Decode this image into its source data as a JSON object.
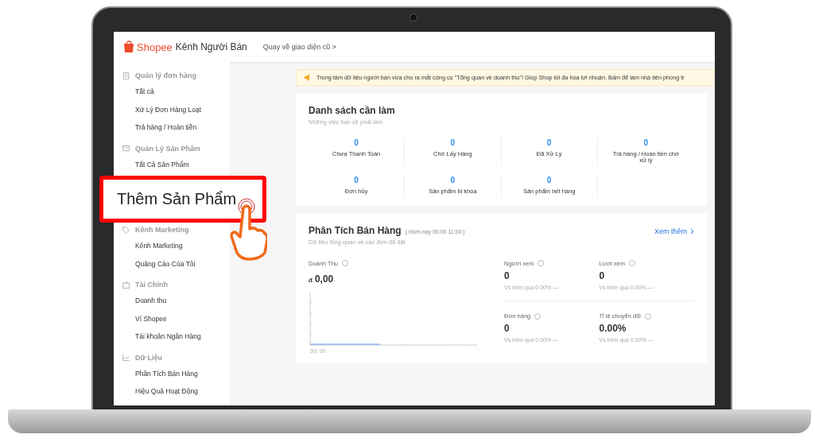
{
  "header": {
    "brand": "Shopee",
    "title": "Kênh Người Bán",
    "link": "Quay về giao diện cũ >"
  },
  "sidebar": {
    "groups": [
      {
        "title": "Quản lý đơn hàng",
        "items": [
          "Tất cả",
          "Xử Lý Đơn Hàng Loạt",
          "Trả hàng / Hoàn tiền"
        ]
      },
      {
        "title": "Quản Lý Sản Phẩm",
        "items": [
          "Tất Cả Sản Phẩm"
        ]
      },
      {
        "title": "Kênh Marketing",
        "items": [
          "Kênh Marketing",
          "Quảng Cáo Của Tôi"
        ]
      },
      {
        "title": "Tài Chính",
        "items": [
          "Doanh thu",
          "Ví Shopee",
          "Tài khoản Ngân Hàng"
        ]
      },
      {
        "title": "Dữ Liệu",
        "items": [
          "Phân Tích Bán Hàng",
          "Hiệu Quả Hoạt Động"
        ]
      }
    ]
  },
  "callout": {
    "label": "Thêm Sản Phẩm"
  },
  "notice": "Trung tâm dữ liệu người bán vừa cho ra mắt công cụ \"Tổng quan về doanh thu\"! Giúp Shop tối đa hóa lợi nhuận. Bấm để làm nhà tiên phong tr",
  "todo": {
    "title": "Danh sách cần làm",
    "subtitle": "Những việc bạn sẽ phải làm",
    "items": [
      {
        "count": "0",
        "label": "Chưa Thanh Toán"
      },
      {
        "count": "0",
        "label": "Chờ Lấy Hàng"
      },
      {
        "count": "0",
        "label": "Đã Xử Lý"
      },
      {
        "count": "0",
        "label": "Trả hàng / Hoàn tiền chờ xử lý"
      },
      {
        "count": "0",
        "label": "Đơn hủy"
      },
      {
        "count": "0",
        "label": "Sản phẩm bị khóa"
      },
      {
        "count": "0",
        "label": "Sản phẩm hết hàng"
      }
    ]
  },
  "sales": {
    "title": "Phân Tích Bán Hàng",
    "period": "( Hôm nay 00:00 11:00 )",
    "subtitle": "Dữ liệu tổng quan về các đơn đã đặt",
    "more": "Xem thêm",
    "revenue_label": "Doanh Thu",
    "currency": "đ",
    "revenue": "0,00",
    "chart_start": "00: 00",
    "stats": [
      {
        "label": "Người xem",
        "value": "0",
        "compare": "Vs hôm qua 0.00% —"
      },
      {
        "label": "Lượt xem",
        "value": "0",
        "compare": "Vs hôm qua 0.00% —"
      },
      {
        "label": "Đơn hàng",
        "value": "0",
        "compare": "Vs hôm qua 0.00% —"
      },
      {
        "label": "Tỉ lệ chuyển đổi",
        "value": "0.00%",
        "compare": "Vs hôm qua 0.00% —"
      }
    ]
  }
}
